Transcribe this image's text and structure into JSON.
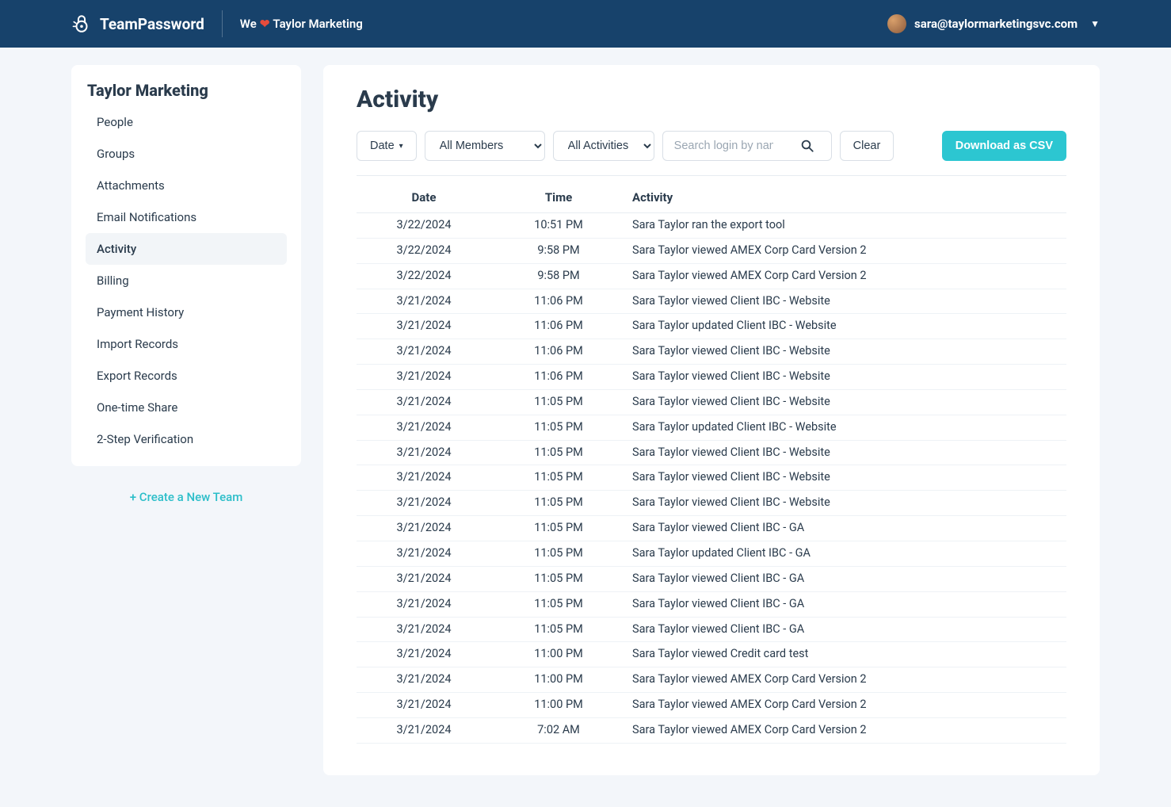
{
  "header": {
    "brand": "TeamPassword",
    "tagline_prefix": "We",
    "tagline_suffix": "Taylor Marketing",
    "user_email": "sara@taylormarketingsvc.com"
  },
  "sidebar": {
    "team_name": "Taylor Marketing",
    "items": [
      {
        "label": "People"
      },
      {
        "label": "Groups"
      },
      {
        "label": "Attachments"
      },
      {
        "label": "Email Notifications"
      },
      {
        "label": "Activity",
        "active": true
      },
      {
        "label": "Billing"
      },
      {
        "label": "Payment History"
      },
      {
        "label": "Import Records"
      },
      {
        "label": "Export Records"
      },
      {
        "label": "One-time Share"
      },
      {
        "label": "2-Step Verification"
      }
    ],
    "new_team": "+ Create a New Team"
  },
  "main": {
    "title": "Activity",
    "toolbar": {
      "date_label": "Date",
      "members_selected": "All Members",
      "activities_selected": "All Activities",
      "search_placeholder": "Search login by name",
      "clear_label": "Clear",
      "csv_label": "Download as CSV"
    },
    "columns": {
      "date": "Date",
      "time": "Time",
      "activity": "Activity"
    },
    "rows": [
      {
        "date": "3/22/2024",
        "time": "10:51 PM",
        "activity": "Sara Taylor ran the export tool"
      },
      {
        "date": "3/22/2024",
        "time": "9:58 PM",
        "activity": "Sara Taylor viewed AMEX Corp Card Version 2"
      },
      {
        "date": "3/22/2024",
        "time": "9:58 PM",
        "activity": "Sara Taylor viewed AMEX Corp Card Version 2"
      },
      {
        "date": "3/21/2024",
        "time": "11:06 PM",
        "activity": "Sara Taylor viewed Client IBC - Website"
      },
      {
        "date": "3/21/2024",
        "time": "11:06 PM",
        "activity": "Sara Taylor updated Client IBC - Website"
      },
      {
        "date": "3/21/2024",
        "time": "11:06 PM",
        "activity": "Sara Taylor viewed Client IBC - Website"
      },
      {
        "date": "3/21/2024",
        "time": "11:06 PM",
        "activity": "Sara Taylor viewed Client IBC - Website"
      },
      {
        "date": "3/21/2024",
        "time": "11:05 PM",
        "activity": "Sara Taylor viewed Client IBC - Website"
      },
      {
        "date": "3/21/2024",
        "time": "11:05 PM",
        "activity": "Sara Taylor updated Client IBC - Website"
      },
      {
        "date": "3/21/2024",
        "time": "11:05 PM",
        "activity": "Sara Taylor viewed Client IBC - Website"
      },
      {
        "date": "3/21/2024",
        "time": "11:05 PM",
        "activity": "Sara Taylor viewed Client IBC - Website"
      },
      {
        "date": "3/21/2024",
        "time": "11:05 PM",
        "activity": "Sara Taylor viewed Client IBC - Website"
      },
      {
        "date": "3/21/2024",
        "time": "11:05 PM",
        "activity": "Sara Taylor viewed Client IBC - GA"
      },
      {
        "date": "3/21/2024",
        "time": "11:05 PM",
        "activity": "Sara Taylor updated Client IBC - GA"
      },
      {
        "date": "3/21/2024",
        "time": "11:05 PM",
        "activity": "Sara Taylor viewed Client IBC - GA"
      },
      {
        "date": "3/21/2024",
        "time": "11:05 PM",
        "activity": "Sara Taylor viewed Client IBC - GA"
      },
      {
        "date": "3/21/2024",
        "time": "11:05 PM",
        "activity": "Sara Taylor viewed Client IBC - GA"
      },
      {
        "date": "3/21/2024",
        "time": "11:00 PM",
        "activity": "Sara Taylor viewed Credit card test"
      },
      {
        "date": "3/21/2024",
        "time": "11:00 PM",
        "activity": "Sara Taylor viewed AMEX Corp Card Version 2"
      },
      {
        "date": "3/21/2024",
        "time": "11:00 PM",
        "activity": "Sara Taylor viewed AMEX Corp Card Version 2"
      },
      {
        "date": "3/21/2024",
        "time": "7:02 AM",
        "activity": "Sara Taylor viewed AMEX Corp Card Version 2"
      }
    ]
  }
}
